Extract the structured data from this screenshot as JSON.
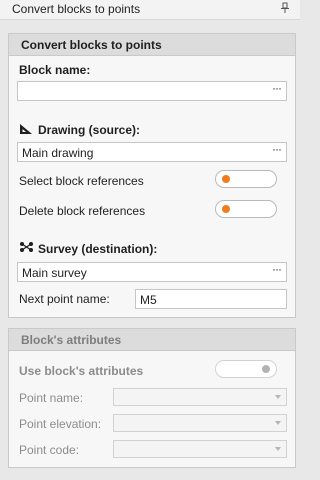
{
  "window": {
    "title": "Convert blocks to points",
    "pin_icon": "pin-icon"
  },
  "main_panel": {
    "header": "Convert blocks to points",
    "block_name": {
      "label": "Block name:",
      "value": ""
    },
    "drawing_source": {
      "label": "Drawing (source):",
      "value": "Main drawing",
      "icon": "triangle-ruler-icon"
    },
    "select_block_references": {
      "label": "Select block references",
      "state": "on"
    },
    "delete_block_references": {
      "label": "Delete block references",
      "state": "on"
    },
    "survey_destination": {
      "label": "Survey (destination):",
      "value": "Main survey",
      "icon": "survey-points-icon"
    },
    "next_point_name": {
      "label": "Next point name:",
      "value": "M5"
    },
    "ellipsis": "···"
  },
  "attributes_panel": {
    "header": "Block's attributes",
    "use_attributes": {
      "label": "Use block's attributes",
      "state": "off"
    },
    "point_name": {
      "label": "Point name:"
    },
    "point_elevation": {
      "label": "Point elevation:"
    },
    "point_code": {
      "label": "Point code:"
    }
  },
  "colors": {
    "accent": "#f07c1c",
    "panel_header": "#dcdcdc",
    "background": "#e8e8e8"
  }
}
